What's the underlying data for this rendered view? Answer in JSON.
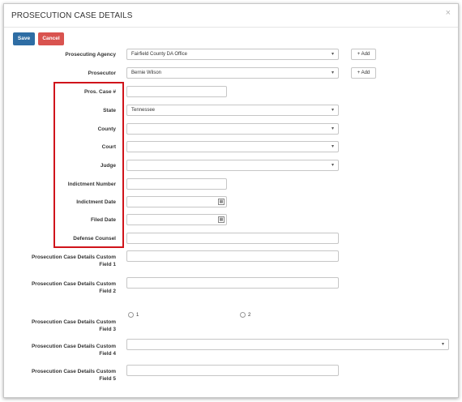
{
  "modal": {
    "title": "PROSECUTION CASE DETAILS",
    "close": "×"
  },
  "toolbar": {
    "save": "Save",
    "cancel": "Cancel"
  },
  "labels": {
    "agency": "Prosecuting Agency",
    "prosecutor": "Prosecutor",
    "case_no": "Pros. Case #",
    "state": "State",
    "county": "County",
    "court": "Court",
    "judge": "Judge",
    "indictment_number": "Indictment Number",
    "indictment_date": "Indictment Date",
    "filed_date": "Filed Date",
    "defense_counsel": "Defense Counsel",
    "custom1": "Prosecution Case Details Custom Field 1",
    "custom2": "Prosecution Case Details Custom Field 2",
    "custom3": "Prosecution Case Details Custom Field 3",
    "custom4": "Prosecution Case Details Custom Field 4",
    "custom5": "Prosecution Case Details Custom Field 5"
  },
  "values": {
    "agency": "Fairfield County DA Office",
    "prosecutor": "Bernie Wilson",
    "state": "Tennessee",
    "county": "",
    "court": "",
    "judge": "",
    "custom4": ""
  },
  "add_label": "+ Add",
  "custom3_options": [
    "1",
    "2"
  ],
  "icons": {
    "caret": "▾",
    "calendar": "▦"
  },
  "colors": {
    "save": "#2e6da4",
    "cancel": "#d9534f",
    "highlight": "#d0141b"
  }
}
